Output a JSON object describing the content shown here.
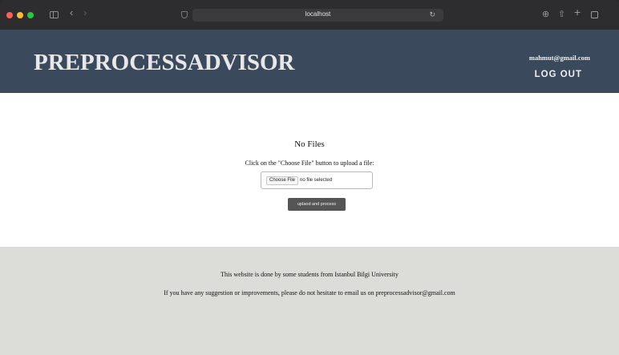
{
  "browser": {
    "address": "localhost",
    "icons": [
      "sidebar-icon",
      "back-icon",
      "forward-icon",
      "shield-icon",
      "reload-icon",
      "download-icon",
      "share-icon",
      "new-tab-icon",
      "tabs-overview-icon"
    ],
    "back_glyph": "‹",
    "forward_glyph": "›",
    "reload_glyph": "↻",
    "download_glyph": "⊕",
    "share_glyph": "⇧",
    "plus_glyph": "+"
  },
  "header": {
    "title": "PREPROCESSADVISOR",
    "email": "mahmut@gmail.com",
    "logout_label": "LOG OUT",
    "bg_color": "#3a4a5c"
  },
  "main": {
    "status": "No Files",
    "instruction": "Click on the \"Choose File\" button to upload a file:",
    "choose_file_label": "Choose File",
    "file_status": "no file selected",
    "upload_label": "uplaod and process"
  },
  "footer": {
    "line1": "This website is done by some students from Istanbul Bilgi University",
    "line2": "If you have any suggestion or improvements, please do not hesitate to email us on preprocessadvisor@gmail.com",
    "bg_color": "#dcdcd8"
  }
}
